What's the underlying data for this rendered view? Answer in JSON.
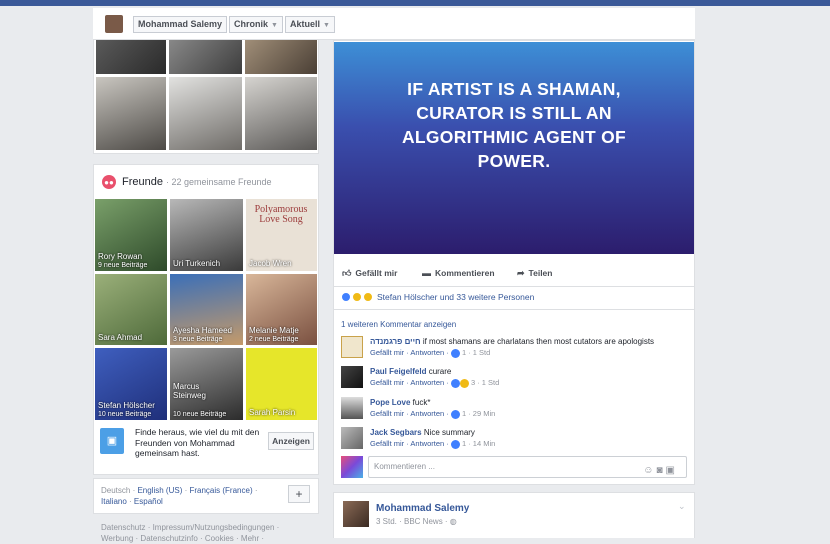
{
  "header": {
    "profile_name": "Mohammad Salemy",
    "chronik_label": "Chronik",
    "aktuell_label": "Aktuell"
  },
  "friends": {
    "title": "Freunde",
    "subtitle": "· 22 gemeinsame Freunde",
    "tiles": [
      {
        "name": "Rory Rowan",
        "sub": "9 neue Beiträge"
      },
      {
        "name": "Uri Turkenich",
        "sub": ""
      },
      {
        "name": "Jacob Wren",
        "sub": ""
      },
      {
        "name": "Sara Ahmad",
        "sub": ""
      },
      {
        "name": "Ayesha Hameed",
        "sub": "3 neue Beiträge"
      },
      {
        "name": "Melanie Matje",
        "sub": "2 neue Beiträge"
      },
      {
        "name": "Stefan Hölscher",
        "sub": "10 neue Beiträge"
      },
      {
        "name": "Marcus Steinweg",
        "sub": "10 neue Beiträge"
      },
      {
        "name": "Sarah Parsin",
        "sub": ""
      }
    ],
    "book_tile_text": "Polyamorous Love Song"
  },
  "find_friends": {
    "text": "Finde heraus, wie viel du mit den Freunden von Mohammad gemeinsam hast.",
    "button": "Anzeigen"
  },
  "languages": {
    "current": "Deutsch",
    "sep1": " · ",
    "lang1": "English (US)",
    "lang2": "Français (France)",
    "lang3": "Italiano",
    "lang4": "Español",
    "plus": "+"
  },
  "footer": {
    "line1": "Datenschutz · Impressum/Nutzungsbedingungen ·",
    "line2": "Werbung · Datenschutzinfo · Cookies · Mehr ·"
  },
  "post": {
    "quote_line1": "IF ARTIST IS A SHAMAN,",
    "quote_line2": "CURATOR IS STILL AN",
    "quote_line3": "ALGORITHMIC AGENT OF",
    "quote_line4": "POWER.",
    "like_label": "Gefällt mir",
    "comment_label": "Kommentieren",
    "share_label": "Teilen",
    "reactions_text": "Stefan Hölscher und 33 weitere Personen",
    "more_comments": "1 weiteren Kommentar anzeigen",
    "comments": [
      {
        "author": "חיים פרגמנדה",
        "text": " if most shamans are charlatans then most cutators are apologists",
        "actions": "Gefällt mir · Antworten ·",
        "stats": " 1 · 1 Std"
      },
      {
        "author": "Paul Feigelfeld",
        "text": " curare",
        "actions": "Gefällt mir · Antworten ·",
        "stats": " 3 · 1 Std"
      },
      {
        "author": "Pope Love",
        "text": " fuck*",
        "actions": "Gefällt mir · Antworten ·",
        "stats": " 1 · 29 Min"
      },
      {
        "author": "Jack Segbars",
        "text": " Nice summary",
        "actions": "Gefällt mir · Antworten ·",
        "stats": " 1 · 14 Min"
      }
    ],
    "comment_placeholder": "Kommentieren ..."
  },
  "next_post": {
    "author": "Mohammad Salemy",
    "meta": "3 Std. · BBC News · ◍"
  },
  "colors": {
    "brand_blue": "#3b5998",
    "link_blue": "#365899"
  }
}
